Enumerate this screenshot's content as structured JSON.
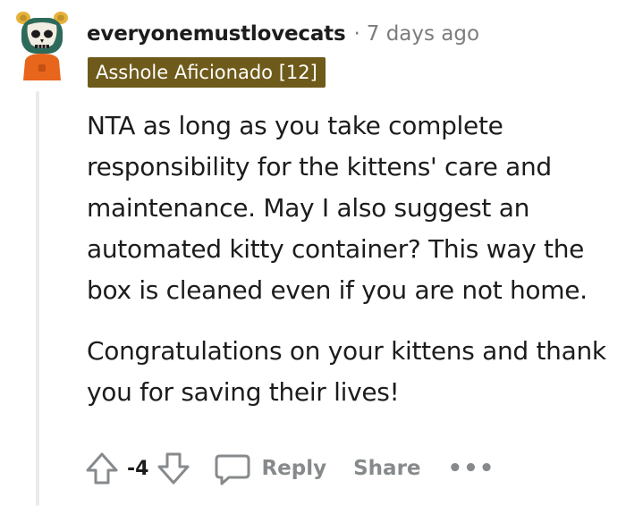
{
  "comment": {
    "username": "everyonemustlovecats",
    "separator": "·",
    "timestamp": "7 days ago",
    "flair": "Asshole Aficionado [12]",
    "paragraphs": [
      "NTA as long as you take complete responsibility for the kittens' care and maintenance. May I also suggest an automated kitty container? This way the box is cleaned even if you are not home.",
      "Congratulations on your kittens and thank you for saving their lives!"
    ],
    "score": "-4",
    "reply_label": "Reply",
    "share_label": "Share",
    "more_label": "•••"
  },
  "colors": {
    "flair_bg": "#6e5a1a",
    "meta_gray": "#7c7c7c",
    "action_gray": "#878a8c",
    "thread_line": "#e9ebed"
  },
  "icons": [
    "avatar",
    "upvote-icon",
    "downvote-icon",
    "comment-bubble-icon",
    "more-options-icon"
  ]
}
